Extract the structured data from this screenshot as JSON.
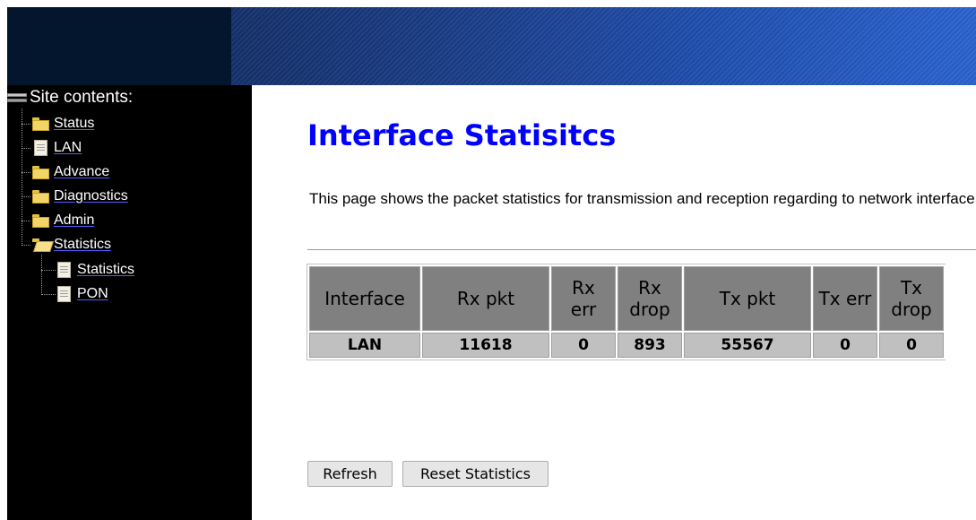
{
  "sidebar": {
    "title": "Site contents:",
    "items": [
      {
        "label": "Status",
        "icon": "folder-icon"
      },
      {
        "label": "LAN",
        "icon": "document-icon"
      },
      {
        "label": "Advance",
        "icon": "folder-icon"
      },
      {
        "label": "Diagnostics",
        "icon": "folder-icon"
      },
      {
        "label": "Admin",
        "icon": "folder-icon"
      },
      {
        "label": "Statistics",
        "icon": "open-folder-icon",
        "expanded": true,
        "children": [
          {
            "label": "Statistics",
            "icon": "document-icon"
          },
          {
            "label": "PON",
            "icon": "document-icon"
          }
        ]
      }
    ]
  },
  "main": {
    "title": "Interface Statisitcs",
    "description": "This page shows the packet statistics for transmission and reception regarding to network interface.",
    "table": {
      "headers": [
        "Interface",
        "Rx pkt",
        "Rx err",
        "Rx drop",
        "Tx pkt",
        "Tx err",
        "Tx drop"
      ],
      "rows": [
        [
          "LAN",
          "11618",
          "0",
          "893",
          "55567",
          "0",
          "0"
        ]
      ]
    },
    "buttons": {
      "refresh": "Refresh",
      "reset": "Reset Statistics"
    }
  },
  "colors": {
    "title": "#0000ff",
    "sidebar_bg": "#000000",
    "table_header_bg": "#808080",
    "table_cell_bg": "#c0c0c0"
  }
}
